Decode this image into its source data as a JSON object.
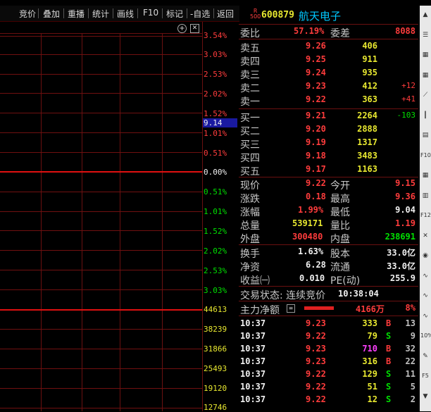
{
  "toolbar": {
    "items": [
      "竞价",
      "叠加",
      "重播",
      "统计",
      "画线",
      "F10",
      "标记",
      "-自选",
      "返回"
    ]
  },
  "chart": {
    "pct_up": [
      "3.54%",
      "3.03%",
      "2.53%",
      "2.02%",
      "1.52%",
      "1.01%",
      "0.51%"
    ],
    "price_marker": "9.14",
    "pct_zero": "0.00%",
    "pct_down": [
      "0.51%",
      "1.01%",
      "1.52%",
      "2.02%",
      "2.53%",
      "3.03%"
    ],
    "volume_ticks": [
      "44613",
      "38239",
      "31866",
      "25493",
      "19120",
      "12746"
    ]
  },
  "stock": {
    "badge_top": "R",
    "badge_bottom": "500",
    "code": "600879",
    "name": "航天电子"
  },
  "order": {
    "weibi_label": "委比",
    "weibi_value": "57.19%",
    "weicha_label": "委差",
    "weicha_value": "8088",
    "sell": [
      {
        "label": "卖五",
        "price": "9.26",
        "vol": "406",
        "chg": ""
      },
      {
        "label": "卖四",
        "price": "9.25",
        "vol": "911",
        "chg": ""
      },
      {
        "label": "卖三",
        "price": "9.24",
        "vol": "935",
        "chg": ""
      },
      {
        "label": "卖二",
        "price": "9.23",
        "vol": "412",
        "chg": "+12"
      },
      {
        "label": "卖一",
        "price": "9.22",
        "vol": "363",
        "chg": "+41"
      }
    ],
    "buy": [
      {
        "label": "买一",
        "price": "9.21",
        "vol": "2264",
        "chg": "-103"
      },
      {
        "label": "买二",
        "price": "9.20",
        "vol": "2888",
        "chg": ""
      },
      {
        "label": "买三",
        "price": "9.19",
        "vol": "1317",
        "chg": ""
      },
      {
        "label": "买四",
        "price": "9.18",
        "vol": "3483",
        "chg": ""
      },
      {
        "label": "买五",
        "price": "9.17",
        "vol": "1163",
        "chg": ""
      }
    ]
  },
  "quote": {
    "xianjia_l": "现价",
    "xianjia": "9.22",
    "jinkai_l": "今开",
    "jinkai": "9.15",
    "zhangdie_l": "涨跌",
    "zhangdie": "0.18",
    "zuigao_l": "最高",
    "zuigao": "9.36",
    "zhangfu_l": "涨幅",
    "zhangfu": "1.99%",
    "zuidi_l": "最低",
    "zuidi": "9.04",
    "zongliang_l": "总量",
    "zongliang": "539171",
    "liangbi_l": "量比",
    "liangbi": "1.19",
    "waipan_l": "外盘",
    "waipan": "300480",
    "neipan_l": "内盘",
    "neipan": "238691",
    "huanshou_l": "换手",
    "huanshou": "1.63%",
    "guben_l": "股本",
    "guben": "33.0亿",
    "jingzi_l": "净资",
    "jingzi": "6.28",
    "liutong_l": "流通",
    "liutong": "33.0亿",
    "shouyi_l": "收益㈠",
    "shouyi": "0.010",
    "pe_l": "PE(动)",
    "pe": "255.9"
  },
  "status": {
    "label": "交易状态: 连续竞价",
    "time": "10:38:04"
  },
  "main_net": {
    "label": "主力净额",
    "value": "4166万",
    "pct": "8%",
    "bar_fraction": 0.6
  },
  "ticks": [
    {
      "t": "10:37",
      "p": "9.23",
      "v": "333",
      "bs": "B",
      "n": "13",
      "pc": "red",
      "vc": "yellow"
    },
    {
      "t": "10:37",
      "p": "9.22",
      "v": "79",
      "bs": "S",
      "n": "9",
      "pc": "red",
      "vc": "yellow"
    },
    {
      "t": "10:37",
      "p": "9.23",
      "v": "710",
      "bs": "B",
      "n": "32",
      "pc": "red",
      "vc": "mag"
    },
    {
      "t": "10:37",
      "p": "9.23",
      "v": "316",
      "bs": "B",
      "n": "22",
      "pc": "red",
      "vc": "yellow"
    },
    {
      "t": "10:37",
      "p": "9.22",
      "v": "129",
      "bs": "S",
      "n": "11",
      "pc": "red",
      "vc": "yellow"
    },
    {
      "t": "10:37",
      "p": "9.22",
      "v": "51",
      "bs": "S",
      "n": "5",
      "pc": "red",
      "vc": "yellow"
    },
    {
      "t": "10:37",
      "p": "9.22",
      "v": "12",
      "bs": "S",
      "n": "2",
      "pc": "red",
      "vc": "yellow"
    }
  ],
  "rightbar": {
    "icons": [
      "chevron-up-icon",
      "list-icon",
      "table-icon",
      "table-icon",
      "line-chart-icon",
      "candle-icon",
      "document-icon",
      "f10-icon",
      "grid-icon",
      "chart-icon",
      "f12-icon",
      "x-icon",
      "fund-icon",
      "wave-icon",
      "wave-icon",
      "wave-icon",
      "percent-icon",
      "pen-icon",
      "f5-icon",
      "chevron-down-icon"
    ],
    "labels": [
      "",
      "",
      "",
      "",
      "",
      "",
      "",
      "F10",
      "",
      "",
      "F12",
      "",
      "",
      "",
      "",
      "",
      "10%",
      "",
      "F5",
      ""
    ]
  }
}
